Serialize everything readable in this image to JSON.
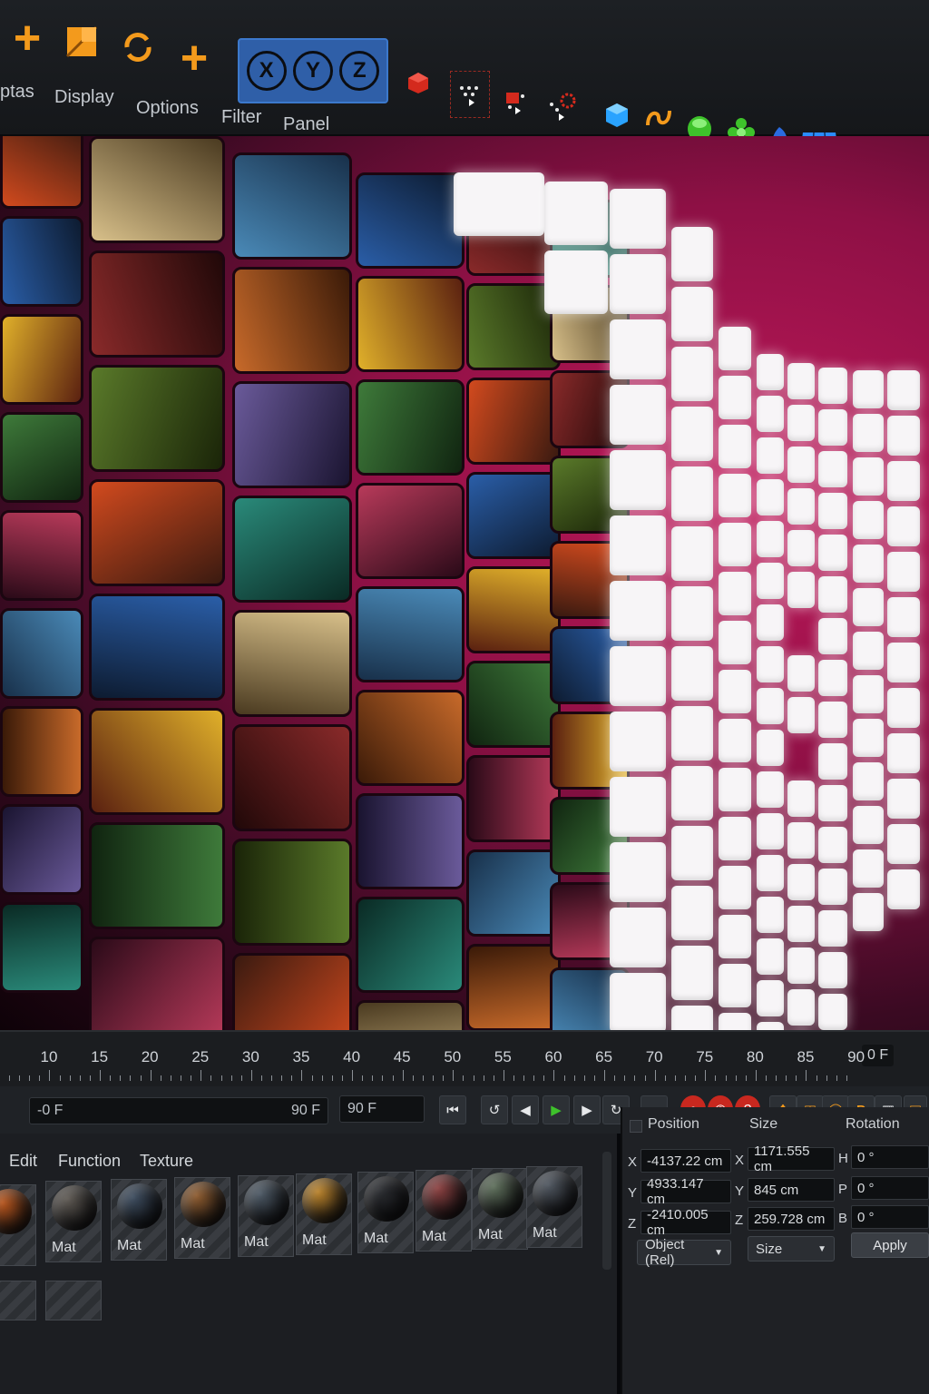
{
  "menu": {
    "items": [
      "ptas",
      "Display",
      "Options",
      "Filter",
      "Panel"
    ]
  },
  "axes": [
    "X",
    "Y",
    "Z"
  ],
  "timeline": {
    "ticks": [
      "10",
      "15",
      "20",
      "25",
      "30",
      "35",
      "40",
      "45",
      "50",
      "55",
      "60",
      "65",
      "70",
      "75",
      "80",
      "85",
      "90"
    ],
    "end_label": "0 F"
  },
  "transport": {
    "current_frame": "-0 F",
    "range_end": "90 F",
    "max_frame": "90 F"
  },
  "material_panel": {
    "tabs": [
      "Edit",
      "Function",
      "Texture"
    ],
    "items": [
      {
        "label": "t",
        "color": "#b5541c"
      },
      {
        "label": "Mat",
        "color": "#5b5650"
      },
      {
        "label": "Mat",
        "color": "#3b4a5c"
      },
      {
        "label": "Mat",
        "color": "#8c5a2e"
      },
      {
        "label": "Mat",
        "color": "#4a5662"
      },
      {
        "label": "Mat",
        "color": "#b8812a"
      },
      {
        "label": "Mat",
        "color": "#2a2c30"
      },
      {
        "label": "Mat",
        "color": "#8a4040"
      },
      {
        "label": "Mat",
        "color": "#5d6e5a"
      },
      {
        "label": "Mat",
        "color": "#4e555e"
      }
    ]
  },
  "attributes": {
    "headers": {
      "position": "Position",
      "size": "Size",
      "rotation": "Rotation"
    },
    "position": {
      "x": "-4137.22 cm",
      "y": "4933.147 cm",
      "z": "-2410.005 cm"
    },
    "size": {
      "x": "1171.555 cm",
      "y": "845 cm",
      "z": "259.728 cm"
    },
    "rotation": {
      "h": "0 °",
      "p": "0 °",
      "b": "0 °"
    },
    "axis_labels": {
      "x": "X",
      "y": "Y",
      "z": "Z",
      "h": "H",
      "p": "P",
      "b": "B"
    },
    "coord_mode": "Object (Rel)",
    "size_mode": "Size",
    "apply_label": "Apply"
  },
  "colors": {
    "accent_orange": "#f39a1c",
    "axis_blue": "#2f5fa8",
    "viewport_magenta": "#c0185a",
    "record_red": "#c8281f"
  }
}
